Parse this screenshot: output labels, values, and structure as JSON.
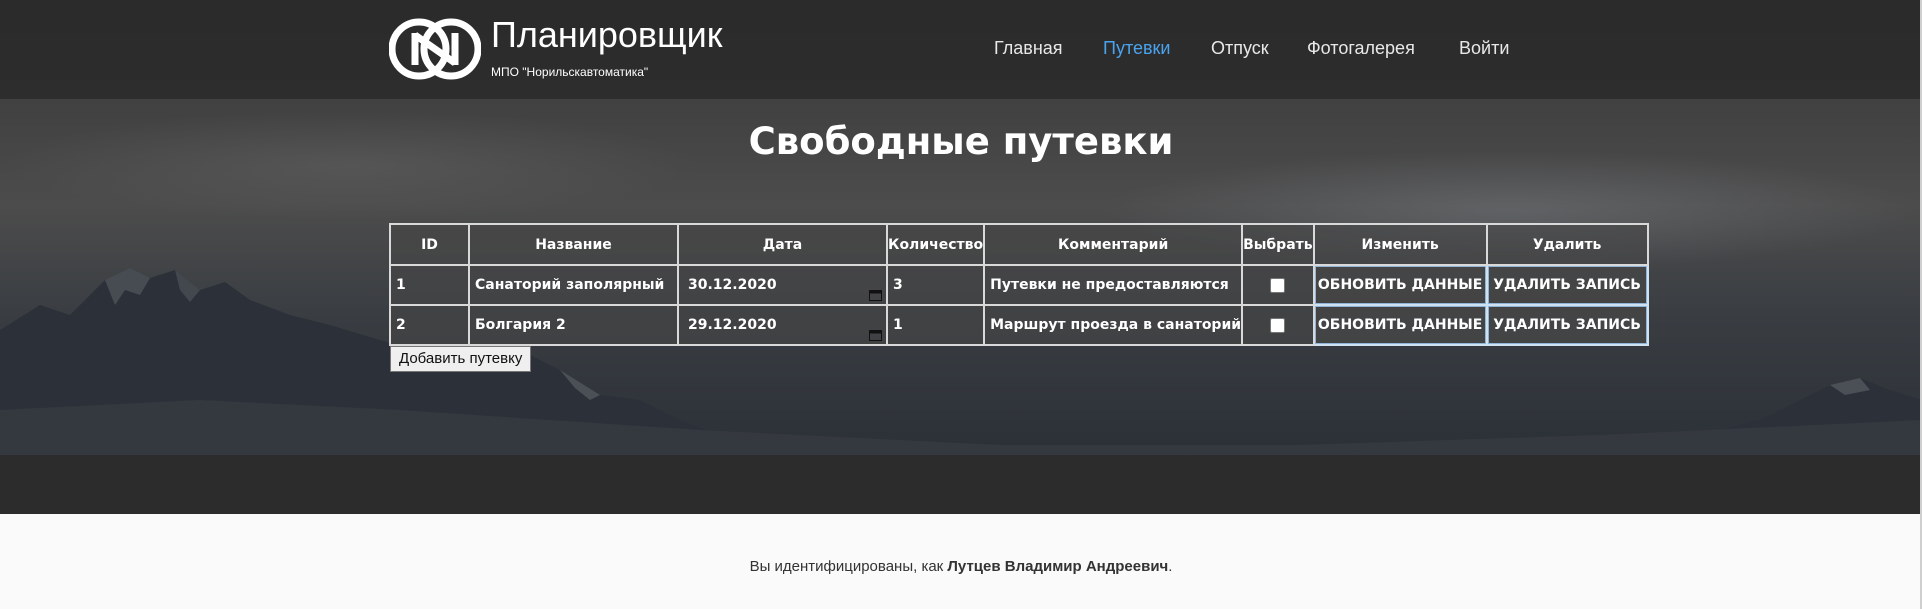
{
  "brand": {
    "title": "Планировщик",
    "subtitle": "МПО \"Норильскавтоматика\"",
    "logo_icon": "letter-n-circle-logo"
  },
  "nav": {
    "items": [
      {
        "label": "Главная",
        "active": false
      },
      {
        "label": "Путевки",
        "active": true
      },
      {
        "label": "Отпуск",
        "active": false
      },
      {
        "label": "Фотогалерея",
        "active": false
      },
      {
        "label": "Войти",
        "active": false
      }
    ],
    "active_color": "#4aa3ef"
  },
  "page_title": "Свободные путевки",
  "table": {
    "headers": [
      "ID",
      "Название",
      "Дата",
      "Количество",
      "Комментарий",
      "Выбрать",
      "Изменить",
      "Удалить"
    ],
    "rows": [
      {
        "id": "1",
        "name": "Санаторий заполярный",
        "date": "30.12.2020",
        "quantity": "3",
        "comment": "Путевки не предоставляются",
        "selected": false,
        "update_label": "ОБНОВИТЬ ДАННЫЕ",
        "delete_label": "УДАЛИТЬ ЗАПИСЬ"
      },
      {
        "id": "2",
        "name": "Болгария 2",
        "date": "29.12.2020",
        "quantity": "1",
        "comment": "Маршрут проезда в санаторий",
        "selected": false,
        "update_label": "ОБНОВИТЬ ДАННЫЕ",
        "delete_label": "УДАЛИТЬ ЗАПИСЬ"
      }
    ]
  },
  "add_button": "Добавить путевку",
  "footer": {
    "prefix": "Вы идентифицированы, как ",
    "user": "Лутцев Владимир Андреевич",
    "suffix": "."
  }
}
